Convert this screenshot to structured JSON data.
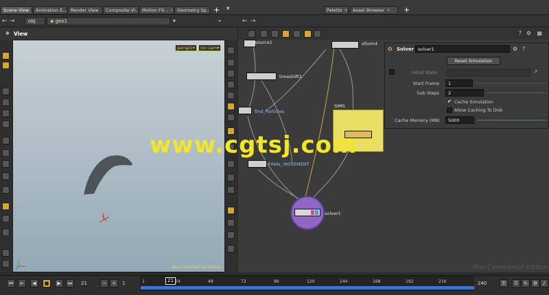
{
  "tabs": [
    {
      "label": "Scene View"
    },
    {
      "label": "Animation E..."
    },
    {
      "label": "Render View"
    },
    {
      "label": "Composite Vi..."
    },
    {
      "label": "Motion FX..."
    },
    {
      "label": "Geometry Sp..."
    }
  ],
  "right_tabs": [
    {
      "label": "Palette"
    },
    {
      "label": "Asset Browser"
    }
  ],
  "path": {
    "obj": "obj",
    "geo": "geo1"
  },
  "viewport": {
    "title": "View",
    "camera_menu": "persp1",
    "cam_menu": "no cam",
    "edition_note": "Non-Commercial Edition"
  },
  "network": {
    "nodes": [
      {
        "label": "source1"
      },
      {
        "label": "xform4"
      },
      {
        "label": "timeshift1"
      },
      {
        "label": "find_Particles"
      },
      {
        "label": "SIMS"
      },
      {
        "label": "FINAL_MOVEMENT"
      },
      {
        "label": "solver1"
      }
    ],
    "edition_note": "Non-Commercial Edition"
  },
  "params": {
    "node_type": "Solver",
    "node_name": "solver1",
    "reset_button": "Reset Simulation",
    "initial_state_label": "Initial State",
    "start_frame_label": "Start Frame",
    "start_frame": "1",
    "sub_steps_label": "Sub Steps",
    "sub_steps": "2",
    "cache_sim_label": "Cache Simulation",
    "cache_disk_label": "Allow Caching To Disk",
    "cache_mem_label": "Cache Memory (MB)",
    "cache_mem": "5000"
  },
  "timeline": {
    "current_frame": "21",
    "start": "1",
    "end": "240",
    "ticks": [
      "1",
      "24",
      "48",
      "72",
      "96",
      "120",
      "144",
      "168",
      "192",
      "216"
    ],
    "marker": "21"
  },
  "watermark": "www.cgtsj.com",
  "colors": {
    "accent": "#d6a630",
    "subnet": "#e8df64",
    "solver_ring": "#7a4fb0"
  }
}
